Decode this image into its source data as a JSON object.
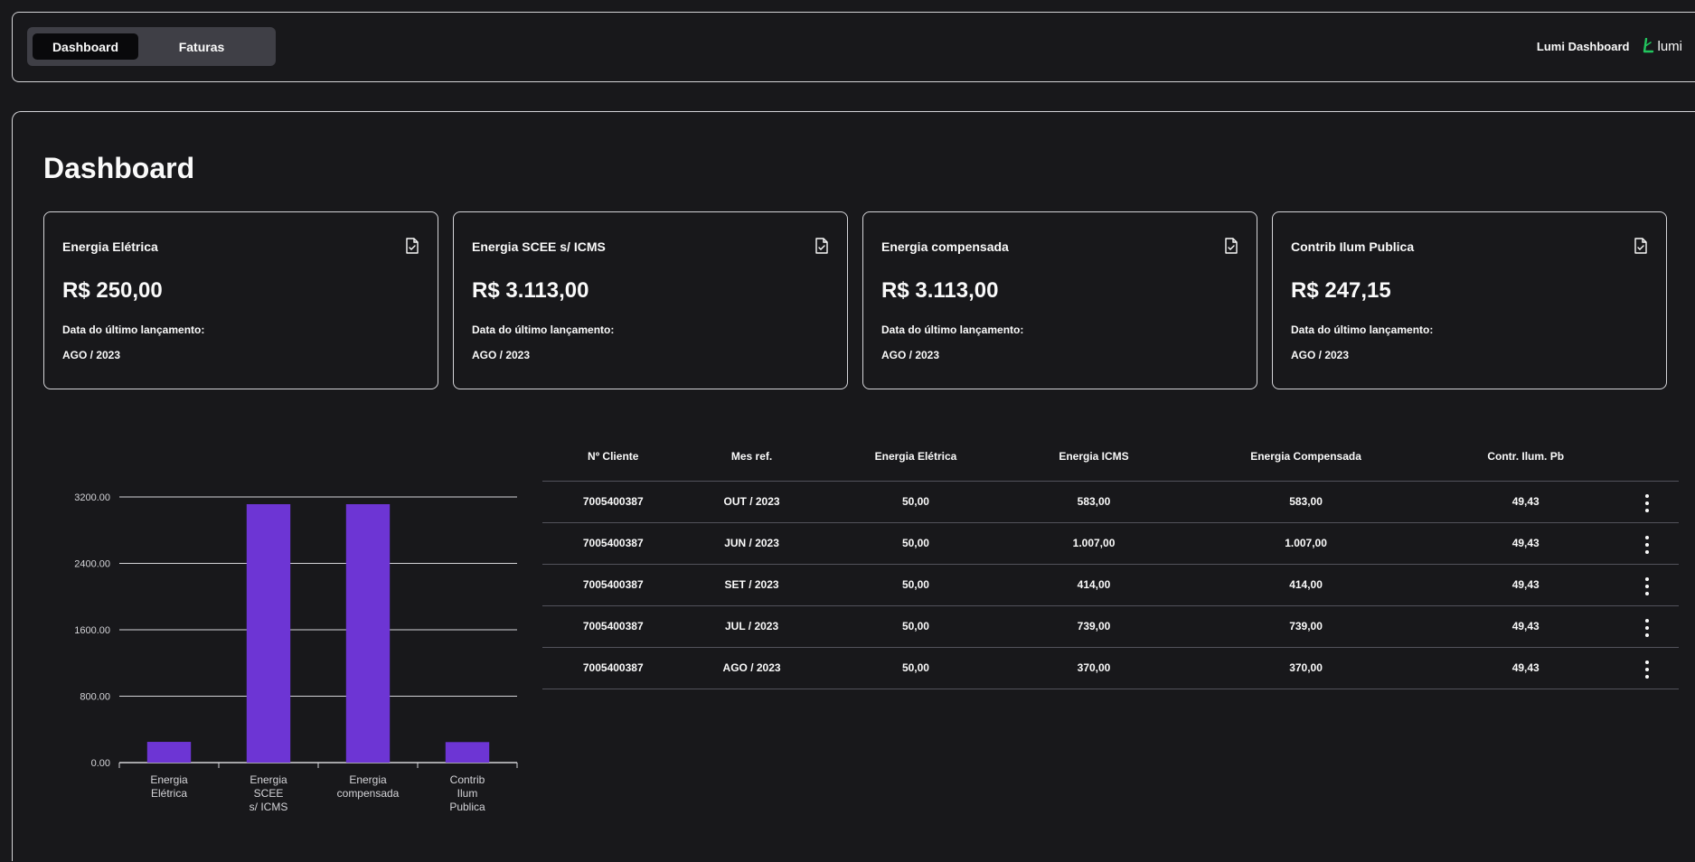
{
  "nav": {
    "tabs": [
      {
        "label": "Dashboard",
        "active": true
      },
      {
        "label": "Faturas",
        "active": false
      }
    ],
    "app_title": "Lumi Dashboard",
    "logo_text": "lumi",
    "logo_color": "#22c55e"
  },
  "main": {
    "title": "Dashboard",
    "cards": [
      {
        "title": "Energia Elétrica",
        "value": "R$ 250,00",
        "label": "Data do último lançamento:",
        "date": "AGO / 2023",
        "icon": "file-check-icon"
      },
      {
        "title": "Energia SCEE s/ ICMS",
        "value": "R$ 3.113,00",
        "label": "Data do último lançamento:",
        "date": "AGO / 2023",
        "icon": "file-check-icon"
      },
      {
        "title": "Energia compensada",
        "value": "R$ 3.113,00",
        "label": "Data do último lançamento:",
        "date": "AGO / 2023",
        "icon": "file-check-icon"
      },
      {
        "title": "Contrib Ilum Publica",
        "value": "R$ 247,15",
        "label": "Data do último lançamento:",
        "date": "AGO / 2023",
        "icon": "file-check-icon"
      }
    ],
    "table": {
      "headers": [
        "Nº Cliente",
        "Mes ref.",
        "Energia Elétrica",
        "Energia ICMS",
        "Energia Compensada",
        "Contr. Ilum. Pb"
      ],
      "rows": [
        [
          "7005400387",
          "OUT / 2023",
          "50,00",
          "583,00",
          "583,00",
          "49,43"
        ],
        [
          "7005400387",
          "JUN / 2023",
          "50,00",
          "1.007,00",
          "1.007,00",
          "49,43"
        ],
        [
          "7005400387",
          "SET / 2023",
          "50,00",
          "414,00",
          "414,00",
          "49,43"
        ],
        [
          "7005400387",
          "JUL / 2023",
          "50,00",
          "739,00",
          "739,00",
          "49,43"
        ],
        [
          "7005400387",
          "AGO / 2023",
          "50,00",
          "370,00",
          "370,00",
          "49,43"
        ]
      ]
    }
  },
  "chart_data": {
    "type": "bar",
    "categories": [
      [
        "Energia",
        "Elétrica"
      ],
      [
        "Energia",
        "SCEE",
        "s/ ICMS"
      ],
      [
        "Energia",
        "compensada"
      ],
      [
        "Contrib",
        "Ilum",
        "Publica"
      ]
    ],
    "values": [
      250,
      3113,
      3113,
      247.15
    ],
    "ylim": [
      0,
      3200
    ],
    "yticks": [
      "0.00",
      "800.00",
      "1600.00",
      "2400.00",
      "3200.00"
    ],
    "grid": true,
    "bar_color": "#6d35d4"
  }
}
